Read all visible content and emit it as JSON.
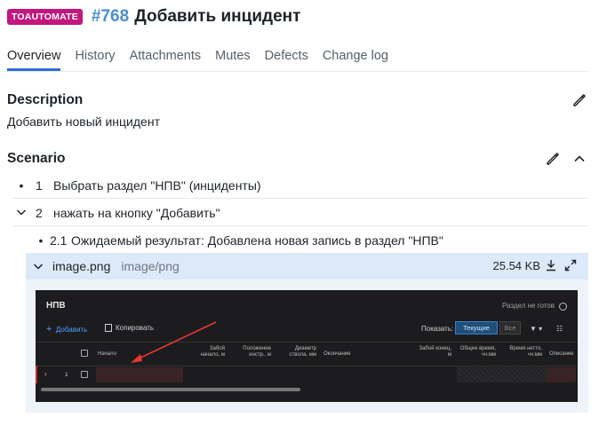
{
  "header": {
    "badge": "TOAUTOMATE",
    "issue_id": "#768",
    "title": "Добавить инцидент"
  },
  "tabs": [
    {
      "label": "Overview",
      "active": true
    },
    {
      "label": "History"
    },
    {
      "label": "Attachments"
    },
    {
      "label": "Mutes"
    },
    {
      "label": "Defects"
    },
    {
      "label": "Change log"
    }
  ],
  "description": {
    "title": "Description",
    "text": "Добавить новый инцидент"
  },
  "scenario": {
    "title": "Scenario",
    "steps": [
      {
        "marker": "•",
        "num": "1",
        "text": "Выбрать раздел \"НПВ\" (инциденты)"
      },
      {
        "marker": "chevron-down",
        "num": "2",
        "text": "нажать на кнопку \"Добавить\""
      },
      {
        "marker": "•",
        "num": "2.1",
        "text": "Ожидаемый результат: Добавлена новая запись в раздел \"НПВ\""
      }
    ]
  },
  "attachment": {
    "name": "image.png",
    "type": "image/png",
    "size": "25.54 KB"
  },
  "embedded_screenshot": {
    "title": "НПВ",
    "status": "Раздел не готов",
    "add": "Добавить",
    "copy": "Копировать",
    "show_label": "Показать:",
    "current": "Текущие",
    "all": "Все",
    "columns": [
      {
        "l1": "Начало",
        "l2": ""
      },
      {
        "l1": "Забой",
        "l2": "начало, м"
      },
      {
        "l1": "Положение",
        "l2": "инстр., м"
      },
      {
        "l1": "Диаметр",
        "l2": "ствола, мм"
      },
      {
        "l1": "Окончание",
        "l2": ""
      },
      {
        "l1": "Забой конец,",
        "l2": "м"
      },
      {
        "l1": "Общее время,",
        "l2": "чч:мм"
      },
      {
        "l1": "Время нетто,",
        "l2": "чч:мм"
      },
      {
        "l1": "Описание",
        "l2": ""
      }
    ],
    "row_num": "1"
  },
  "colors": {
    "badge": "#c2187c",
    "issue_id": "#4a8fd1",
    "active_tab": "#2f6fd3",
    "attachment_bar": "#dce9f9",
    "arrow": "#e53935"
  }
}
